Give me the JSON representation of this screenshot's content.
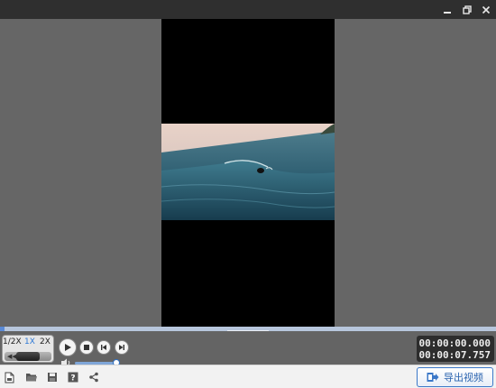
{
  "window": {
    "pin_icon": "pin-icon",
    "restore_icon": "restore-icon",
    "close_icon": "close-icon"
  },
  "player": {
    "progress_fraction": 0.0
  },
  "controls": {
    "speed_options": [
      "1/2X",
      "1X",
      "2X"
    ],
    "speed_selected": "1X",
    "speed_selected_fraction": 0.5,
    "volume_fraction": 0.92,
    "current_time": "00:00:00.000",
    "total_time": "00:00:07.757"
  },
  "toolbar": {
    "export_label": "导出视频"
  },
  "colors": {
    "accent": "#2f7ad6",
    "seek_track": "#b7c6dc",
    "seek_played": "#5a8ad6",
    "titlebar": "#2f2f2f"
  }
}
